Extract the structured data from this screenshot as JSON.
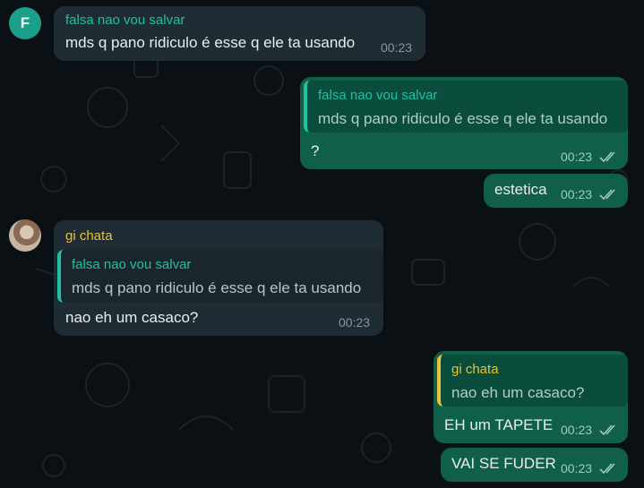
{
  "messages": [
    {
      "direction": "incoming",
      "avatar": "F",
      "sender": "falsa nao vou salvar",
      "text": "mds q pano ridiculo é esse q ele ta usando",
      "time": "00:23"
    },
    {
      "direction": "outgoing",
      "reply": {
        "sender": "falsa nao vou salvar",
        "text": "mds q pano ridiculo é esse q ele ta usando"
      },
      "text": "?",
      "time": "00:23",
      "status_icon": "double-check-icon"
    },
    {
      "direction": "outgoing",
      "text": "estetica",
      "time": "00:23",
      "status_icon": "double-check-icon"
    },
    {
      "direction": "incoming",
      "avatar": "photo",
      "sender": "gi chata",
      "reply": {
        "sender": "falsa nao vou salvar",
        "text": "mds q pano ridiculo é esse q ele ta usando"
      },
      "text": "nao eh um casaco?",
      "time": "00:23"
    },
    {
      "direction": "outgoing",
      "reply": {
        "sender": "gi chata",
        "text": "nao eh um casaco?"
      },
      "text": "EH um TAPETE",
      "time": "00:23",
      "status_icon": "double-check-icon"
    },
    {
      "direction": "outgoing",
      "text": "VAI SE FUDER",
      "time": "00:23",
      "status_icon": "double-check-icon"
    }
  ],
  "colors": {
    "background": "#0b1014",
    "incoming_bubble": "#1f2c33",
    "outgoing_bubble": "#0f5f4a",
    "name_green": "#20c0a0",
    "name_yellow": "#e9c13a"
  }
}
